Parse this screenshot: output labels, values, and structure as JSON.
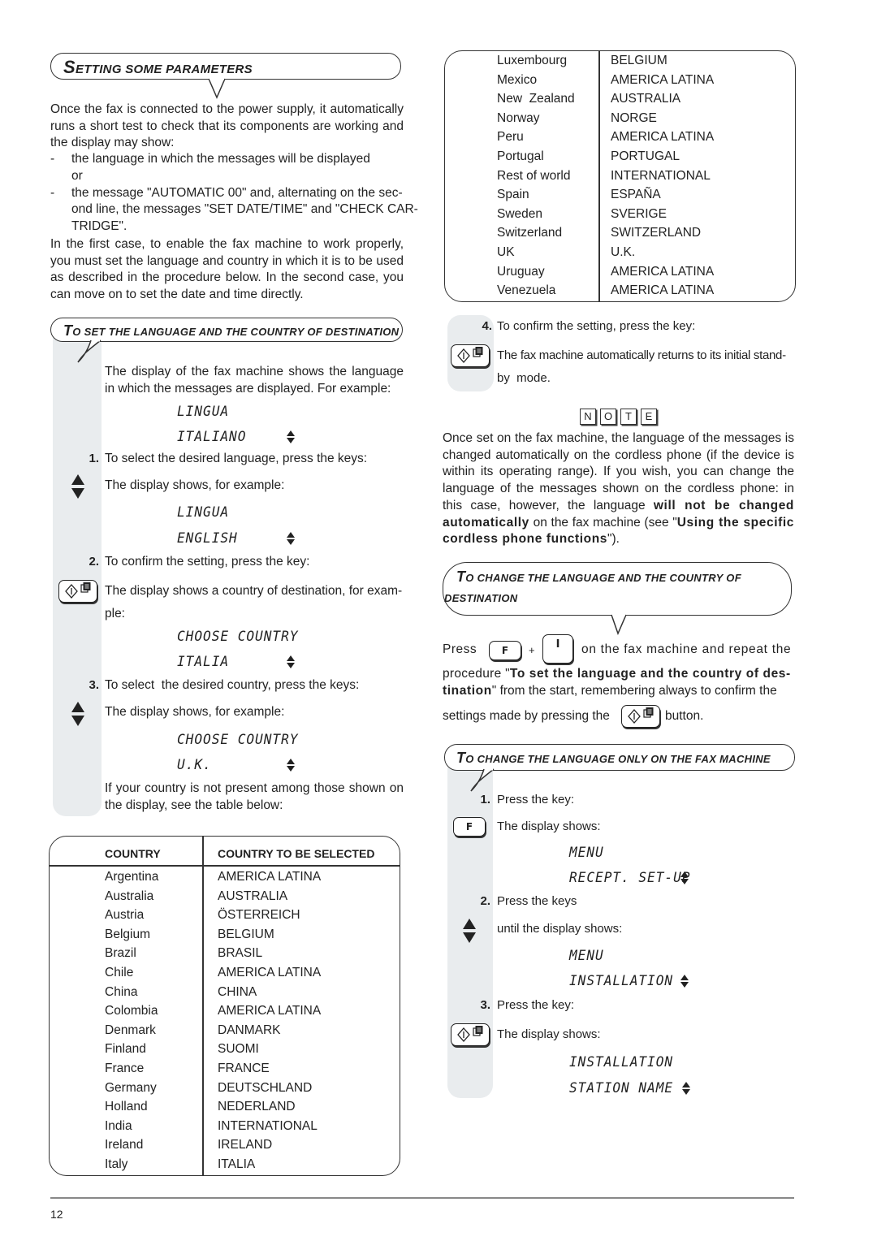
{
  "page": {
    "page_number": "12"
  },
  "section_title": {
    "cap": "S",
    "rest": "etting some parameters"
  },
  "intro": {
    "p1": "Once the fax is connected to the power supply, it automatically runs a short test to check that its components are working and the display may show:",
    "bullets": [
      {
        "dash": "-",
        "text": "the language in which the messages will be displayed"
      },
      {
        "dash": "",
        "text": "or"
      },
      {
        "dash": "-",
        "text": "the message \"AUTOMATIC   00\" and, alternating on the second line, the messages \"SET DATE/TIME\" and \"CHECK CARTRIDGE\"."
      }
    ],
    "bullet_lines": [
      "the language in which the messages will be displayed",
      "or",
      "the message \"AUTOMATIC   00\" and, alternating on the sec-",
      "ond line, the messages \"SET DATE/TIME\" and \"CHECK CAR-",
      "TRIDGE\"."
    ],
    "p2": "In the first case, to enable the fax machine to work properly, you must set the language and country in which it is to be used as described in the procedure below. In the second case, you can move on to set the date and time directly."
  },
  "set_language": {
    "title_cap": "T",
    "title_rest": "o set the language and the country of destination",
    "intro": "The display of the fax machine shows the language in which the messages are displayed. For example:",
    "display1": {
      "line1": "LINGUA",
      "line2": "ITALIANO"
    },
    "step1": {
      "num": "1.",
      "text": "To select the desired language, press the keys:"
    },
    "step1_display_label": "The display shows, for example:",
    "display2": {
      "line1": "LINGUA",
      "line2": "ENGLISH"
    },
    "step2": {
      "num": "2.",
      "text": "To confirm the setting, press the key:"
    },
    "step2_desc_line1": "The display shows a country of destination, for exam-",
    "step2_desc_line2": "ple:",
    "display3": {
      "line1": "CHOOSE COUNTRY",
      "line2": "ITALIA"
    },
    "step3": {
      "num": "3.",
      "text": "To select  the desired country, press the keys:"
    },
    "step3_display_label": "The display shows, for example:",
    "display4": {
      "line1": "CHOOSE COUNTRY",
      "line2": "U.K."
    },
    "footer": "If your country is not present among those shown on the display, see the table below:"
  },
  "country_table": {
    "headers": [
      "COUNTRY",
      "COUNTRY TO BE SELECTED"
    ],
    "rows_part1": [
      [
        "Argentina",
        "AMERICA LATINA"
      ],
      [
        "Australia",
        "AUSTRALIA"
      ],
      [
        "Austria",
        "ÖSTERREICH"
      ],
      [
        "Belgium",
        "BELGIUM"
      ],
      [
        "Brazil",
        "BRASIL"
      ],
      [
        "Chile",
        "AMERICA LATINA"
      ],
      [
        "China",
        "CHINA"
      ],
      [
        "Colombia",
        "AMERICA LATINA"
      ],
      [
        "Denmark",
        "DANMARK"
      ],
      [
        "Finland",
        "SUOMI"
      ],
      [
        "France",
        "FRANCE"
      ],
      [
        "Germany",
        "DEUTSCHLAND"
      ],
      [
        "Holland",
        "NEDERLAND"
      ],
      [
        "India",
        "INTERNATIONAL"
      ],
      [
        "Ireland",
        "IRELAND"
      ],
      [
        "Italy",
        "ITALIA"
      ]
    ],
    "rows_part2": [
      [
        "Luxembourg",
        "BELGIUM"
      ],
      [
        "Mexico",
        "AMERICA LATINA"
      ],
      [
        "New  Zealand",
        "AUSTRALIA"
      ],
      [
        "Norway",
        "NORGE"
      ],
      [
        "Peru",
        "AMERICA LATINA"
      ],
      [
        "Portugal",
        "PORTUGAL"
      ],
      [
        "Rest of world",
        "INTERNATIONAL"
      ],
      [
        "Spain",
        "ESPAÑA"
      ],
      [
        "Sweden",
        "SVERIGE"
      ],
      [
        "Switzerland",
        "SWITZERLAND"
      ],
      [
        "UK",
        "U.K."
      ],
      [
        "Uruguay",
        "AMERICA LATINA"
      ],
      [
        "Venezuela",
        "AMERICA LATINA"
      ]
    ]
  },
  "step4": {
    "num": "4.",
    "text": "To confirm the setting, press the key:",
    "desc_line1": "The fax machine automatically returns to its initial stand-",
    "desc_line2": "by  mode."
  },
  "note": {
    "letters": [
      "N",
      "O",
      "T",
      "E"
    ],
    "text_parts": [
      {
        "bold": false,
        "text": "Once set on the fax machine, the language of the messages is changed automatically on the cordless phone (if the device is within its operating range). If you wish, you can change the language of the messages shown on the cordless phone: in this case, however, the language "
      },
      {
        "bold": true,
        "text": "will not be changed automatically"
      },
      {
        "bold": false,
        "text": " on the fax machine (see \""
      },
      {
        "bold": true,
        "text": "Using the specific cordless phone functions"
      },
      {
        "bold": false,
        "text": "\")."
      }
    ]
  },
  "change_lang_country": {
    "title_cap": "T",
    "title_line1_rest": "o change the language and the country of",
    "title_line2": "destination",
    "press_label": "Press",
    "plus": "+",
    "f_key": "F",
    "i_key": "I",
    "after_keys": "on the fax machine and repeat the",
    "line2_pre": "procedure \"",
    "line2_bold": "To set the language and the country of des-",
    "line3_bold": "tination",
    "line3_rest": "\" from the start, remembering always to confirm the",
    "line4_pre": "settings made by pressing the",
    "line4_post": "button."
  },
  "change_lang_only": {
    "title_cap": "T",
    "title_rest": "o change the language only on the fax machine",
    "step1": {
      "num": "1.",
      "text": "Press the key:",
      "desc": "The display shows:",
      "key": "F"
    },
    "display1": {
      "line1": "MENU",
      "line2": "RECEPT. SET-UP"
    },
    "step2": {
      "num": "2.",
      "text": "Press the keys",
      "desc": "until the display shows:"
    },
    "display2": {
      "line1": "MENU",
      "line2": "INSTALLATION"
    },
    "step3": {
      "num": "3.",
      "text": "Press the key:",
      "desc": "The display shows:"
    },
    "display3": {
      "line1": "INSTALLATION",
      "line2": "STATION NAME"
    }
  }
}
